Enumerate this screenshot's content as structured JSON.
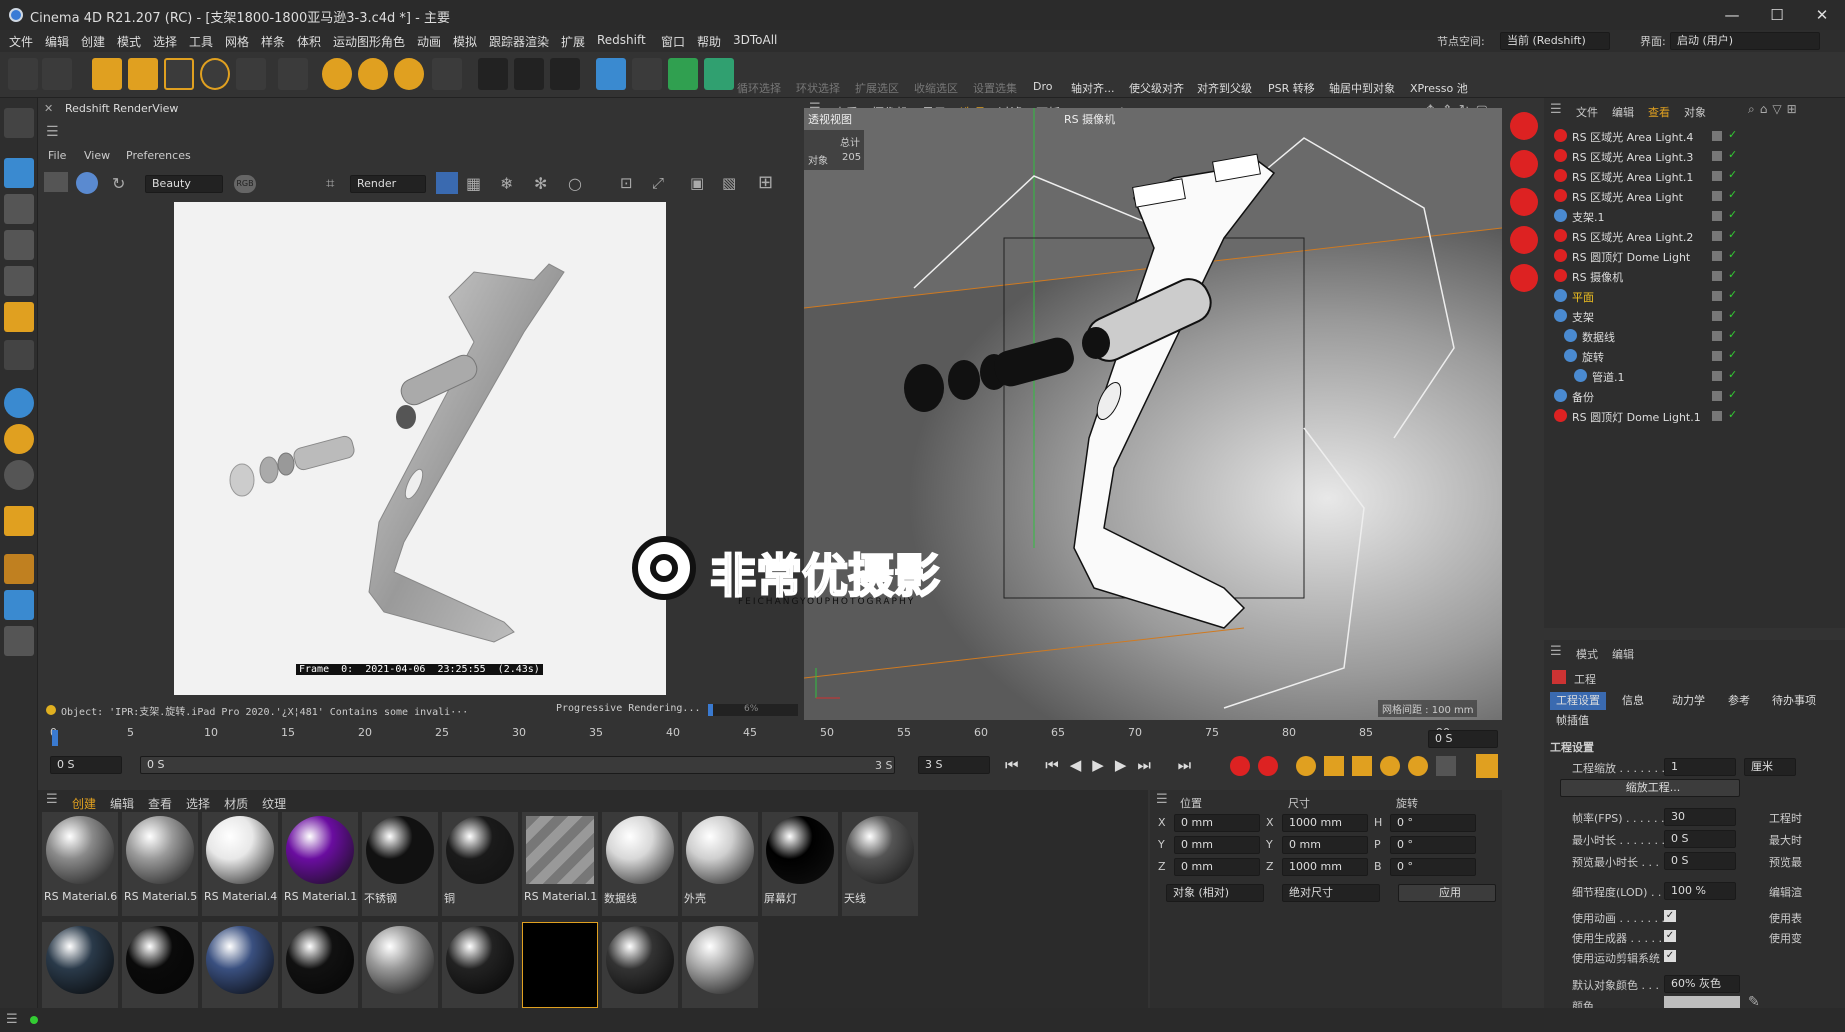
{
  "window": {
    "title": "Cinema 4D R21.207 (RC) - [支架1800-1800亚马逊3-3.c4d *] - 主要"
  },
  "menu": [
    "文件",
    "编辑",
    "创建",
    "模式",
    "选择",
    "工具",
    "网格",
    "样条",
    "体积",
    "运动图形",
    "角色",
    "动画",
    "模拟",
    "跟踪器",
    "渲染",
    "扩展",
    "Redshift",
    "窗口",
    "帮助",
    "3DToAll"
  ],
  "node_space": {
    "label": "节点空间:",
    "value": "当前 (Redshift)"
  },
  "layout": {
    "label": "界面:",
    "value": "启动 (用户)"
  },
  "toolbar_labels": [
    "循环选择",
    "环状选择",
    "扩展选区",
    "收缩选区",
    "设置选集",
    "Dro",
    "轴对齐...",
    "使父级对齐",
    "对齐到父级",
    "PSR 转移",
    "轴居中到对象",
    "XPresso 池"
  ],
  "renderview": {
    "title": "Redshift RenderView",
    "menu": [
      "File",
      "View",
      "Preferences"
    ],
    "aov": "Beauty",
    "render_mode": "Render",
    "frame_caption": "Frame  0:  2021-04-06  23:25:55  (2.43s)",
    "status_text": "Object: 'IPR:支架.旋转.iPad Pro 2020.'¿X¦481' Contains some invali···",
    "progress_label": "Progressive Rendering...",
    "progress_value": "6%"
  },
  "viewport": {
    "menu": [
      "查看",
      "摄像机",
      "显示",
      "选项",
      "过滤",
      "面板",
      "ProRender"
    ],
    "name": "透视视图",
    "camera": "RS 摄像机",
    "stats_header": "总计",
    "stats_label": "对象",
    "stats_value": "205",
    "grid": "网格间距 : 100 mm"
  },
  "object_manager": {
    "menu": [
      "文件",
      "编辑",
      "查看",
      "对象"
    ],
    "items": [
      {
        "name": "RS 区域光 Area Light.4",
        "indent": 0
      },
      {
        "name": "RS 区域光 Area Light.3",
        "indent": 0
      },
      {
        "name": "RS 区域光 Area Light.1",
        "indent": 0
      },
      {
        "name": "RS 区域光 Area Light",
        "indent": 0
      },
      {
        "name": "支架.1",
        "indent": 0
      },
      {
        "name": "RS 区域光 Area Light.2",
        "indent": 0
      },
      {
        "name": "RS 圆顶灯 Dome Light",
        "indent": 0
      },
      {
        "name": "RS 摄像机",
        "indent": 0
      },
      {
        "name": "平面",
        "indent": 0,
        "highlight": true
      },
      {
        "name": "支架",
        "indent": 0
      },
      {
        "name": "数据线",
        "indent": 1
      },
      {
        "name": "旋转",
        "indent": 1
      },
      {
        "name": "管道.1",
        "indent": 2
      },
      {
        "name": "备份",
        "indent": 0
      },
      {
        "name": "RS 圆顶灯 Dome Light.1",
        "indent": 0
      }
    ]
  },
  "attributes": {
    "menu": [
      "模式",
      "编辑"
    ],
    "object": "工程",
    "tabs": [
      "工程设置",
      "信息",
      "动力学",
      "参考",
      "待办事项",
      "帧插值"
    ],
    "section": "工程设置",
    "scale_label": "工程缩放 . . . . . . .",
    "scale_value": "1",
    "scale_unit": "厘米",
    "scale_button": "缩放工程...",
    "fps_label": "帧率(FPS) . . . . . . .",
    "fps_value": "30",
    "project_time": "工程时",
    "min_label": "最小时长 . . . . . . .",
    "min_value": "0 S",
    "max_label": "最大时",
    "pmin_label": "预览最小时长 . . .",
    "pmin_value": "0 S",
    "pmax_label": "预览最",
    "lod_label": "细节程度(LOD) . . .",
    "lod_value": "100 %",
    "edit_label": "编辑渲",
    "chk1": "使用动画 . . . . . . .",
    "chk2": "使用生成器 . . . . .",
    "chk3": "使用运动剪辑系统",
    "chk1r": "使用表",
    "chk2r": "使用变",
    "color_label": "默认对象颜色 . . .",
    "color_value": "60% 灰色",
    "color2_label": "颜色 . . . . . . . . . ."
  },
  "timeline": {
    "ticks": [
      "0",
      "5",
      "10",
      "15",
      "20",
      "25",
      "30",
      "35",
      "40",
      "45",
      "50",
      "55",
      "60",
      "65",
      "70",
      "75",
      "80",
      "85",
      "90"
    ],
    "current": "0 S",
    "start": "0 S",
    "start2": "0 S",
    "end": "3 S",
    "end2": "3 S"
  },
  "materials": {
    "menu": [
      "创建",
      "编辑",
      "查看",
      "选择",
      "材质",
      "纹理"
    ],
    "row1": [
      "RS Material.6",
      "RS Material.5",
      "RS Material.4",
      "RS Material.1",
      "不锈钢",
      "铜",
      "RS Material.1",
      "数据线",
      "外壳",
      "屏幕灯",
      "天线"
    ],
    "row1_colors": [
      "#8a8a8a",
      "#9a9a9a",
      "#e8e8e8",
      "#6a0da0",
      "#111111",
      "#1a1a1a",
      "stripe",
      "#d8d8d8",
      "#cfcfcf",
      "#000000",
      "#555555"
    ]
  },
  "coords": {
    "headers": [
      "位置",
      "尺寸",
      "旋转"
    ],
    "rows": [
      {
        "a": "X",
        "av": "0 mm",
        "b": "X",
        "bv": "1000 mm",
        "c": "H",
        "cv": "0 °"
      },
      {
        "a": "Y",
        "av": "0 mm",
        "b": "Y",
        "bv": "0 mm",
        "c": "P",
        "cv": "0 °"
      },
      {
        "a": "Z",
        "av": "0 mm",
        "b": "Z",
        "bv": "1000 mm",
        "c": "B",
        "cv": "0 °"
      }
    ],
    "mode": "对象 (相对)",
    "size_mode": "绝对尺寸",
    "apply": "应用"
  },
  "watermark": {
    "title": "非常优摄影",
    "subtitle": "FEICHANGYOUPHOTOGRAPHY"
  }
}
